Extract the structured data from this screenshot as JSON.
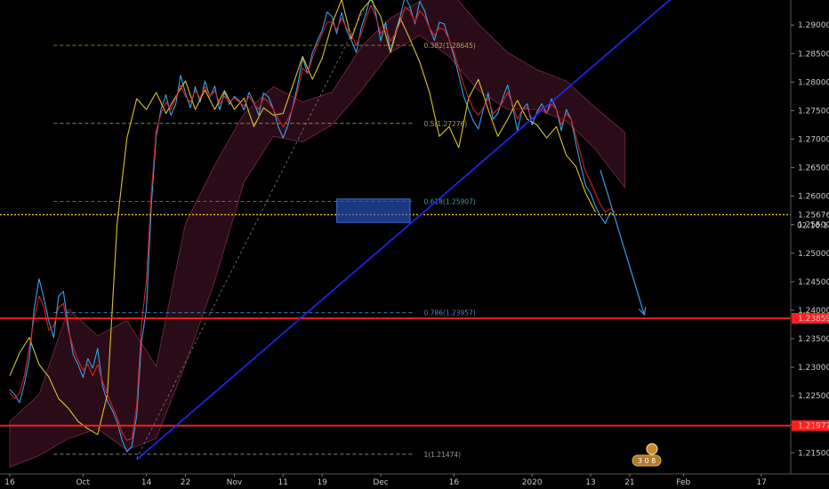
{
  "chart_data": {
    "type": "line",
    "instrument_note": "",
    "ylim": [
      1.2113,
      1.2944
    ],
    "y_ticks": [
      "1.29000",
      "1.28500",
      "1.28000",
      "1.27500",
      "1.27000",
      "1.26500",
      "1.26000",
      "1.25500",
      "1.25000",
      "1.24500",
      "1.24000",
      "1.23500",
      "1.23000",
      "1.22500",
      "1.22000",
      "1.21500"
    ],
    "x_ticks": [
      {
        "label": "16",
        "day": 0
      },
      {
        "label": "Oct",
        "day": 15
      },
      {
        "label": "14",
        "day": 28
      },
      {
        "label": "22",
        "day": 36
      },
      {
        "label": "Nov",
        "day": 46
      },
      {
        "label": "11",
        "day": 56
      },
      {
        "label": "19",
        "day": 64
      },
      {
        "label": "Dec",
        "day": 76
      },
      {
        "label": "16",
        "day": 91
      },
      {
        "label": "2020",
        "day": 107
      },
      {
        "label": "13",
        "day": 119
      },
      {
        "label": "21",
        "day": 127
      },
      {
        "label": "Feb",
        "day": 138
      },
      {
        "label": "17",
        "day": 154
      }
    ],
    "current_price": {
      "price": "1.25676",
      "value": 1.25676,
      "countdown": "02:16:14",
      "color": "#f0c419"
    },
    "horizontal_levels": [
      {
        "price": "1.23859",
        "value": 1.23859,
        "color": "#ff1f1f"
      },
      {
        "price": "1.21977",
        "value": 1.21977,
        "color": "#ff1f1f"
      }
    ],
    "fibonacci": [
      {
        "label": "0.382(1.28645)",
        "value": 1.28645,
        "color": "#b5a642"
      },
      {
        "label": "0.5(1.27276)",
        "value": 1.27276,
        "color": "#9e9e4a"
      },
      {
        "label": "0.618(1.25907)",
        "value": 1.25907,
        "color": "#3fa0a0"
      },
      {
        "label": "0.786(1.23957)",
        "value": 1.23957,
        "color": "#4a86c5"
      },
      {
        "label": "1(1.21474)",
        "value": 1.21474,
        "color": "#9a9a9a"
      }
    ],
    "fib_start_day": 9,
    "fib_end_day": 83,
    "trendline": {
      "day1": 26,
      "price1": 1.2138,
      "day2": 136,
      "price2": 1.295,
      "color": "#2424ff"
    },
    "projection_arrow": {
      "day1": 121,
      "price1": 1.2646,
      "day2": 130,
      "price2": 1.2392,
      "color": "#3a8fd8"
    },
    "highlight_zone": {
      "day1": 67,
      "day2": 82,
      "price_top": 1.2595,
      "price_bottom": 1.2554,
      "color": "#2a56c6"
    },
    "series": [
      {
        "color": "#3f9fe8",
        "x": [
          0,
          1,
          2,
          3,
          4,
          5,
          6,
          7,
          8,
          9,
          10,
          11,
          12,
          13,
          14,
          15,
          16,
          17,
          18,
          19,
          20,
          21,
          22,
          23,
          24,
          25,
          26,
          27,
          28,
          29,
          30,
          31,
          32,
          33,
          34,
          35,
          36,
          37,
          38,
          39,
          40,
          41,
          42,
          43,
          44,
          45,
          46,
          47,
          48,
          49,
          50,
          51,
          52,
          53,
          54,
          55,
          56,
          57,
          58,
          59,
          60,
          61,
          62,
          63,
          64,
          65,
          66,
          67,
          68,
          69,
          70,
          71,
          72,
          73,
          74,
          75,
          76,
          77,
          78,
          79,
          80,
          81,
          82,
          83,
          84,
          85,
          86,
          87,
          88,
          89,
          90,
          91,
          92,
          93,
          94,
          95,
          96,
          97,
          98,
          99,
          100,
          101,
          102,
          103,
          104,
          105,
          106,
          107,
          108,
          109,
          110,
          111,
          112,
          113,
          114,
          115,
          116,
          117,
          118,
          119,
          120,
          121,
          122,
          123,
          124
        ],
        "y": [
          1.2261,
          1.2252,
          1.2238,
          1.2271,
          1.2315,
          1.2402,
          1.2455,
          1.2421,
          1.2381,
          1.2352,
          1.2425,
          1.2433,
          1.2371,
          1.2322,
          1.2305,
          1.2282,
          1.2315,
          1.2298,
          1.2333,
          1.2267,
          1.2241,
          1.2225,
          1.2204,
          1.2172,
          1.2152,
          1.2161,
          1.2215,
          1.2345,
          1.2402,
          1.2583,
          1.2705,
          1.2753,
          1.2778,
          1.2742,
          1.2761,
          1.2812,
          1.2781,
          1.2755,
          1.2792,
          1.2765,
          1.2802,
          1.2774,
          1.2793,
          1.2751,
          1.2782,
          1.2761,
          1.2775,
          1.2768,
          1.2751,
          1.2782,
          1.2765,
          1.2742,
          1.2781,
          1.2774,
          1.2753,
          1.2722,
          1.2702,
          1.2725,
          1.2758,
          1.2795,
          1.2843,
          1.2815,
          1.2851,
          1.2872,
          1.2891,
          1.2923,
          1.2915,
          1.2885,
          1.2922,
          1.2891,
          1.2873,
          1.2852,
          1.2895,
          1.2922,
          1.2953,
          1.2921,
          1.2872,
          1.2905,
          1.2852,
          1.2888,
          1.2915,
          1.2951,
          1.2932,
          1.2902,
          1.2942,
          1.2925,
          1.2895,
          1.2873,
          1.2905,
          1.2902,
          1.2875,
          1.2845,
          1.2812,
          1.2775,
          1.2753,
          1.2731,
          1.2718,
          1.2752,
          1.2781,
          1.2735,
          1.2745,
          1.2772,
          1.2795,
          1.2758,
          1.2715,
          1.2752,
          1.2762,
          1.2725,
          1.2748,
          1.2762,
          1.2745,
          1.2771,
          1.2752,
          1.2715,
          1.2752,
          1.2735,
          1.2692,
          1.2653,
          1.2618,
          1.2605,
          1.2582,
          1.2565,
          1.2552,
          1.2571,
          1.2565
        ]
      },
      {
        "color": "#d8c22f",
        "x": [
          0,
          2,
          4,
          6,
          8,
          10,
          12,
          14,
          16,
          18,
          20,
          22,
          24,
          26,
          28,
          30,
          32,
          34,
          36,
          38,
          40,
          42,
          44,
          46,
          48,
          50,
          52,
          54,
          56,
          58,
          60,
          62,
          64,
          66,
          68,
          70,
          72,
          74,
          76,
          78,
          80,
          82,
          84,
          86,
          88,
          90,
          92,
          94,
          96,
          98,
          100,
          102,
          104,
          106,
          108,
          110,
          112,
          114,
          116,
          118,
          120
        ],
        "y": [
          1.2285,
          1.2325,
          1.2352,
          1.2305,
          1.2283,
          1.2245,
          1.2228,
          1.2205,
          1.2192,
          1.2182,
          1.2252,
          1.2552,
          1.2702,
          1.2771,
          1.2752,
          1.2782,
          1.2745,
          1.2775,
          1.2802,
          1.2752,
          1.2786,
          1.2752,
          1.2785,
          1.2752,
          1.2772,
          1.2722,
          1.2755,
          1.2742,
          1.2745,
          1.2795,
          1.2845,
          1.2805,
          1.2842,
          1.2902,
          1.2945,
          1.2876,
          1.2925,
          1.2945,
          1.2915,
          1.2852,
          1.2912,
          1.2875,
          1.2835,
          1.2782,
          1.2705,
          1.2722,
          1.2685,
          1.2772,
          1.2805,
          1.2752,
          1.2705,
          1.2735,
          1.2768,
          1.2735,
          1.2725,
          1.2702,
          1.2722,
          1.2672,
          1.2652,
          1.2605,
          1.2572
        ]
      },
      {
        "color": "#d61f1f",
        "x": [
          0,
          1,
          2,
          3,
          4,
          5,
          6,
          7,
          8,
          9,
          10,
          11,
          12,
          13,
          14,
          15,
          16,
          17,
          18,
          19,
          20,
          21,
          22,
          23,
          24,
          25,
          26,
          27,
          28,
          29,
          30,
          31,
          32,
          33,
          34,
          35,
          36,
          37,
          38,
          39,
          40,
          41,
          42,
          43,
          44,
          45,
          46,
          47,
          48,
          49,
          50,
          51,
          52,
          53,
          54,
          55,
          56,
          57,
          58,
          59,
          60,
          61,
          62,
          63,
          64,
          65,
          66,
          67,
          68,
          69,
          70,
          71,
          72,
          73,
          74,
          75,
          76,
          77,
          78,
          79,
          80,
          81,
          82,
          83,
          84,
          85,
          86,
          87,
          88,
          89,
          90,
          91,
          92,
          93,
          94,
          95,
          96,
          97,
          98,
          99,
          100,
          101,
          102,
          103,
          104,
          105,
          106,
          107,
          108,
          109,
          110,
          111,
          112,
          113,
          114,
          115,
          116,
          117,
          118,
          119,
          120,
          121,
          122,
          123,
          124
        ],
        "y": [
          1.2255,
          1.2245,
          1.2255,
          1.2285,
          1.2335,
          1.2385,
          1.2425,
          1.2405,
          1.2365,
          1.2372,
          1.2405,
          1.2412,
          1.2365,
          1.2335,
          1.2312,
          1.2295,
          1.2305,
          1.2285,
          1.2305,
          1.2275,
          1.2252,
          1.2232,
          1.2212,
          1.2185,
          1.2172,
          1.2175,
          1.2232,
          1.2375,
          1.2452,
          1.2605,
          1.2715,
          1.2745,
          1.2765,
          1.2752,
          1.2772,
          1.2795,
          1.2775,
          1.2765,
          1.2785,
          1.2772,
          1.2792,
          1.2775,
          1.2785,
          1.2762,
          1.2775,
          1.2765,
          1.2772,
          1.2765,
          1.2758,
          1.2775,
          1.2762,
          1.2752,
          1.2772,
          1.2765,
          1.2752,
          1.2735,
          1.2722,
          1.2735,
          1.2755,
          1.2785,
          1.2825,
          1.2815,
          1.2842,
          1.2865,
          1.2885,
          1.2905,
          1.2905,
          1.2892,
          1.2912,
          1.2895,
          1.2882,
          1.2865,
          1.2885,
          1.2912,
          1.2935,
          1.2915,
          1.2885,
          1.2895,
          1.2872,
          1.2885,
          1.2905,
          1.2932,
          1.2925,
          1.2905,
          1.2925,
          1.2915,
          1.2895,
          1.2882,
          1.2895,
          1.2892,
          1.2875,
          1.2852,
          1.2825,
          1.2795,
          1.2772,
          1.2752,
          1.2742,
          1.2755,
          1.2772,
          1.2745,
          1.2752,
          1.2765,
          1.2782,
          1.2762,
          1.2735,
          1.2752,
          1.2755,
          1.2735,
          1.2745,
          1.2755,
          1.2745,
          1.2762,
          1.2752,
          1.2725,
          1.2745,
          1.2735,
          1.2705,
          1.2672,
          1.2642,
          1.2625,
          1.2605,
          1.2585,
          1.2572,
          1.2578,
          1.2572
        ]
      }
    ],
    "cloud": {
      "color": "#5a1a36",
      "x": [
        0,
        6,
        12,
        18,
        24,
        30,
        36,
        42,
        48,
        54,
        60,
        66,
        72,
        78,
        84,
        90,
        96,
        102,
        108,
        114,
        120,
        126
      ],
      "upper": [
        1.2205,
        1.2252,
        1.2402,
        1.2355,
        1.2382,
        1.2302,
        1.2552,
        1.2655,
        1.2745,
        1.2792,
        1.2765,
        1.2782,
        1.2862,
        1.2912,
        1.2942,
        1.2962,
        1.2902,
        1.2852,
        1.2822,
        1.2802,
        1.2755,
        1.2712
      ],
      "lower": [
        1.2125,
        1.2145,
        1.2175,
        1.2192,
        1.2155,
        1.2175,
        1.2305,
        1.2452,
        1.2625,
        1.2705,
        1.2695,
        1.2725,
        1.2785,
        1.2852,
        1.2882,
        1.2845,
        1.2785,
        1.2752,
        1.2752,
        1.2732,
        1.2682,
        1.2615
      ]
    }
  },
  "badge": {
    "icon": "bitcoin-coins-icon",
    "text": "3 0 8"
  }
}
